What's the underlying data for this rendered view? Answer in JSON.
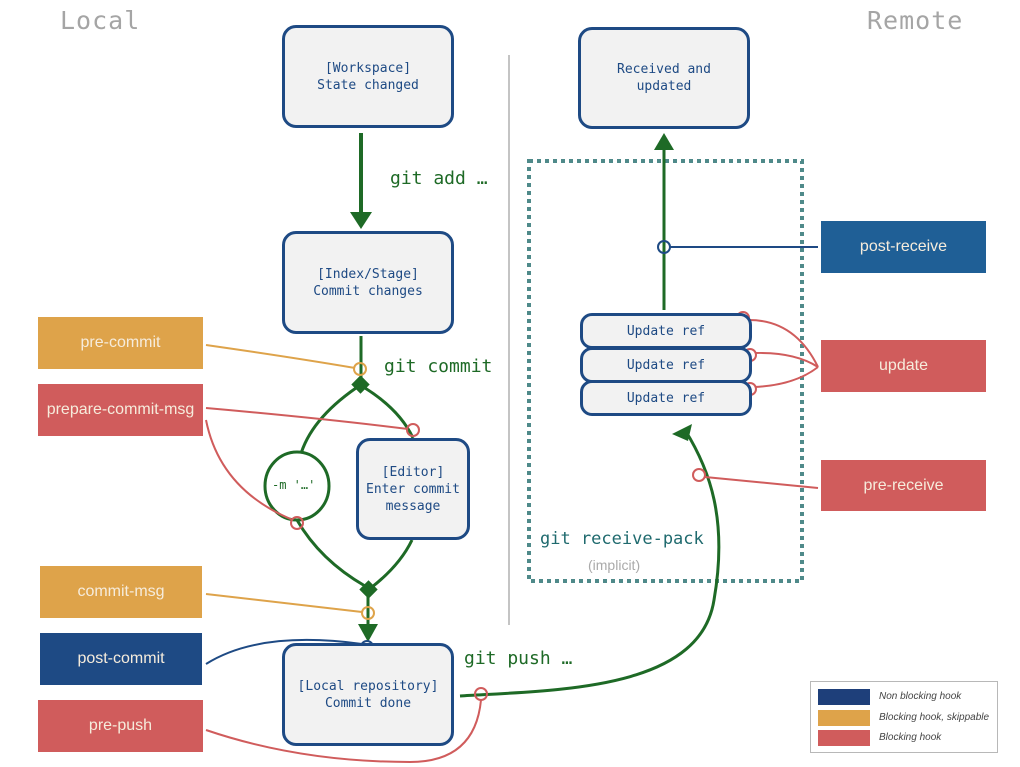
{
  "headings": {
    "local": "Local",
    "remote": "Remote"
  },
  "colors": {
    "non_blocking": "#1e4a84",
    "post_receive": "#1f5f96",
    "blocking_skippable": "#dea34a",
    "blocking": "#d05c5c",
    "flow_arrow": "#1e6a26",
    "state_border": "#1e4a84",
    "receive_pack_border": "#4f8a8a"
  },
  "states": {
    "workspace": "[Workspace]\nState changed",
    "index": "[Index/Stage]\nCommit changes",
    "editor": "[Editor]\nEnter commit\nmessage",
    "local_repo": "[Local repository]\nCommit done",
    "remote_done": "Received and\nupdated"
  },
  "message_option": "-m '…'",
  "update_refs": [
    "Update ref",
    "Update ref",
    "Update ref"
  ],
  "commands": {
    "git_add": "git add …",
    "git_commit": "git commit",
    "git_push": "git push …",
    "git_receive_pack": "git receive-pack",
    "implicit": "(implicit)"
  },
  "hooks": {
    "local": [
      {
        "label": "pre-commit",
        "type": "blocking_skippable"
      },
      {
        "label": "prepare-commit-msg",
        "type": "blocking"
      },
      {
        "label": "commit-msg",
        "type": "blocking_skippable"
      },
      {
        "label": "post-commit",
        "type": "non_blocking"
      },
      {
        "label": "pre-push",
        "type": "blocking"
      }
    ],
    "remote": [
      {
        "label": "post-receive",
        "type": "non_blocking"
      },
      {
        "label": "update",
        "type": "blocking"
      },
      {
        "label": "pre-receive",
        "type": "blocking"
      }
    ]
  },
  "legend": [
    {
      "label": "Non blocking hook",
      "color": "#1e3f7a"
    },
    {
      "label": "Blocking hook, skippable",
      "color": "#dea34a"
    },
    {
      "label": "Blocking hook",
      "color": "#d05c5c"
    }
  ]
}
